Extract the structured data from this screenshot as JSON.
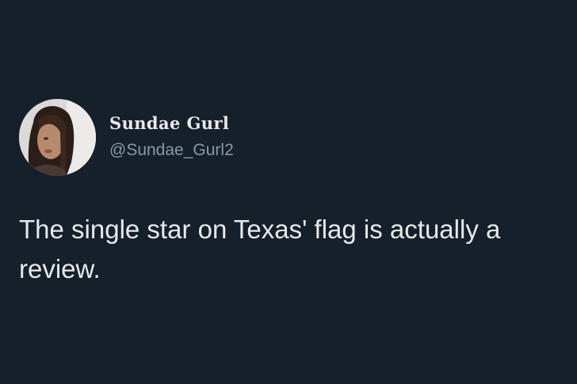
{
  "tweet": {
    "author": {
      "display_name": "Sundae Gurl",
      "handle": "@Sundae_Gurl2",
      "avatar_icon": "profile-photo"
    },
    "text": "The single star on Texas' flag is actually a review."
  },
  "colors": {
    "background": "#15202b",
    "primary_text": "#e7e9ea",
    "secondary_text": "#8b98a5"
  }
}
